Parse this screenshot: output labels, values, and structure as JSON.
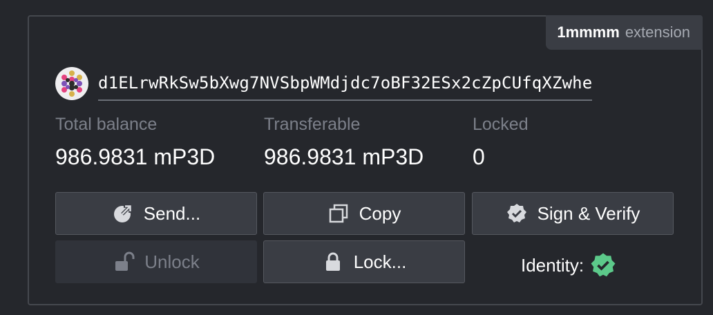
{
  "extension": {
    "name": "1mmmm",
    "type": "extension"
  },
  "account": {
    "address": "d1ELrwRkSw5bXwg7NVSbpWMdjdc7oBF32ESx2cZpCUfqXZwhe",
    "identicon": "identicon-icon"
  },
  "balances": {
    "total": {
      "label": "Total balance",
      "value": "986.9831 mP3D"
    },
    "transferable": {
      "label": "Transferable",
      "value": "986.9831 mP3D"
    },
    "locked": {
      "label": "Locked",
      "value": "0"
    }
  },
  "actions": {
    "send": {
      "label": "Send...",
      "icon": "send-icon"
    },
    "copy": {
      "label": "Copy",
      "icon": "copy-icon"
    },
    "sign": {
      "label": "Sign & Verify",
      "icon": "badge-check-icon"
    },
    "unlock": {
      "label": "Unlock",
      "icon": "unlock-icon",
      "disabled": true
    },
    "lock": {
      "label": "Lock...",
      "icon": "lock-icon"
    }
  },
  "identity": {
    "label": "Identity:",
    "icon": "verified-icon",
    "status_color": "#5cc98a"
  },
  "colors": {
    "background": "#25272c",
    "button": "#3a3d44",
    "muted": "#7c808a"
  }
}
